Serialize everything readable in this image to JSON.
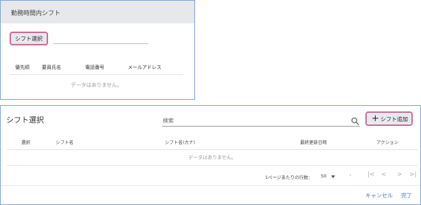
{
  "panel_top": {
    "title": "勤務時間内シフト",
    "select_button": "シフト選択",
    "columns": [
      "優先順",
      "要員氏名",
      "電話番号",
      "メールアドレス"
    ],
    "empty_message": "データはありません。"
  },
  "panel_bottom": {
    "title": "シフト選択",
    "search_placeholder": "検索",
    "add_button": "シフト追加",
    "add_icon": "+",
    "columns": [
      "選択",
      "シフト名",
      "シフト名(カナ)",
      "最終更新日時",
      "アクション"
    ],
    "empty_message": "データはありません。",
    "pagination": {
      "rows_per_page_label": "1ページあたりの行数：",
      "rows_per_page_value": "50",
      "range_text": "-",
      "first": "|<",
      "prev": "<",
      "next": ">",
      "last": ">|"
    },
    "cancel_label": "キャンセル",
    "done_label": "完了"
  },
  "colors": {
    "accent_border": "#c66d97",
    "panel_border": "#7aa3d0",
    "link": "#3d7fc5"
  }
}
